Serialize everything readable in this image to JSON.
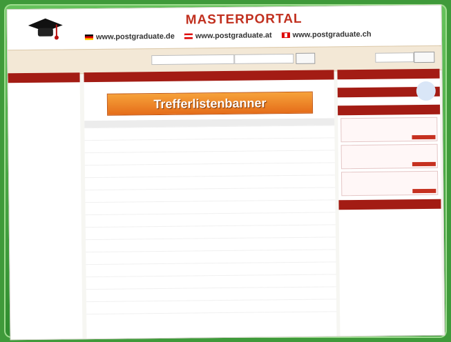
{
  "header": {
    "brand": "MASTERPORTAL",
    "sites": [
      "www.postgraduate.de",
      "www.postgraduate.at",
      "www.postgraduate.ch"
    ]
  },
  "main": {
    "banner": "Trefferlistenbanner"
  },
  "colors": {
    "frame_green": "#3f9a3a",
    "banner_orange": "#f08a2b",
    "band_red": "#a31c14",
    "link_blue": "#315b9d"
  }
}
